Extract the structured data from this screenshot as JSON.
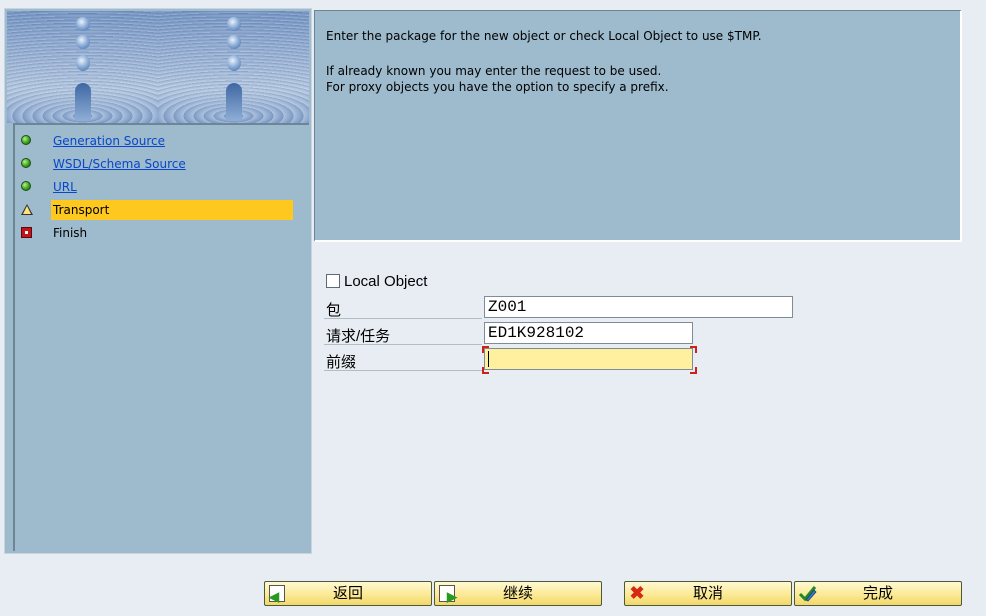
{
  "wizard": {
    "steps": [
      {
        "label": "Generation Source",
        "status": "green",
        "link": true
      },
      {
        "label": "WSDL/Schema Source",
        "status": "green",
        "link": true
      },
      {
        "label": "URL",
        "status": "green",
        "link": true
      },
      {
        "label": "Transport",
        "status": "yellow",
        "link": false,
        "active": true
      },
      {
        "label": "Finish",
        "status": "red",
        "link": false
      }
    ]
  },
  "info": {
    "line1": "Enter the package for the new object or check Local Object to use $TMP.",
    "line2": "If already known you may enter the request to be used.",
    "line3": "For proxy objects you have the option to specify a prefix."
  },
  "form": {
    "local_object_label": "Local Object",
    "local_object_checked": false,
    "package_label": "包",
    "package_value": "Z001",
    "request_label": "请求/任务",
    "request_value": "ED1K928102",
    "prefix_label": "前缀",
    "prefix_value": ""
  },
  "buttons": {
    "back": "返回",
    "continue": "继续",
    "cancel": "取消",
    "complete": "完成"
  },
  "colors": {
    "active_highlight": "#ffc81e",
    "panel_bg": "#9dbbcc",
    "link": "#0a46c8",
    "button_bg": "#fbe890"
  }
}
